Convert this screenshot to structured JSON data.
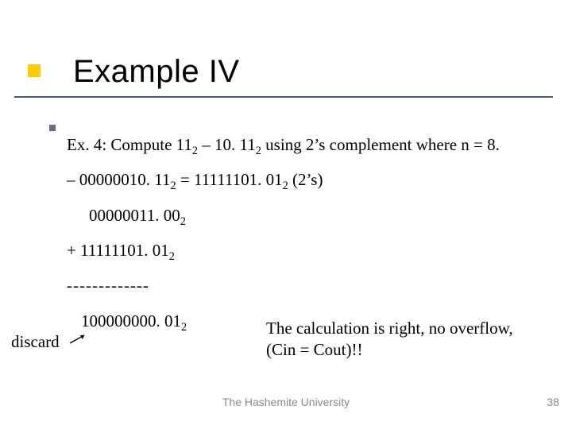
{
  "title": "Example IV",
  "problem": {
    "lead": "Ex. 4: Compute 11",
    "sub1": "2",
    "mid": " – 10. 11",
    "sub2": "2",
    "tail": " using 2’s complement where n = 8."
  },
  "conversion": {
    "p1": "– 00000010. 11",
    "s1": "2",
    "p2": " = 11111101. 01",
    "s2": "2",
    "p3": " (2’s)"
  },
  "operand1": {
    "text": "00000011. 00",
    "sub": "2"
  },
  "operand2": {
    "plus": "+   ",
    "text": "11111101. 01",
    "sub": "2"
  },
  "dashes": "-------------",
  "result": {
    "text": "100000000. 01",
    "sub": "2"
  },
  "discard_label": "discard",
  "note_line1": "The calculation is right, no overflow,",
  "note_line2": "(Cin = Cout)!!",
  "footer": {
    "university": "The Hashemite University",
    "page": "38"
  }
}
